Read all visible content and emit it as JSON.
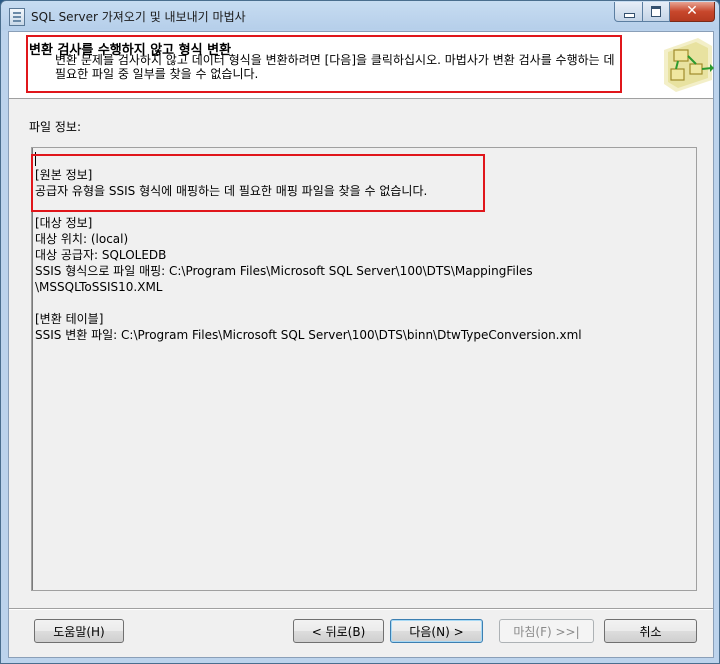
{
  "window": {
    "title": "SQL Server 가져오기 및 내보내기 마법사"
  },
  "header": {
    "title": "변환 검사를 수행하지 않고 형식 변환",
    "description": "변환 문제를 검사하지 않고 데이터 형식을 변환하려면 [다음]을 클릭하십시오. 마법사가 변환 검사를 수행하는 데 필요한 파일 중 일부를 찾을 수 없습니다."
  },
  "file_info_label": "파일 정보:",
  "info": {
    "source_header": "[원본 정보]",
    "source_line": "공급자 유형을 SSIS 형식에 매핑하는 데 필요한 매핑 파일을 찾을 수 없습니다.",
    "dest_header": "[대상 정보]",
    "dest_location": "대상 위치: (local)",
    "dest_provider": "대상 공급자: SQLOLEDB",
    "dest_mapping_1": "SSIS 형식으로 파일 매핑: C:\\Program Files\\Microsoft SQL Server\\100\\DTS\\MappingFiles",
    "dest_mapping_2": "\\MSSQLToSSIS10.XML",
    "conv_header": "[변환 테이블]",
    "conv_file": "SSIS 변환 파일: C:\\Program Files\\Microsoft SQL Server\\100\\DTS\\binn\\DtwTypeConversion.xml"
  },
  "buttons": {
    "help": "도움말(H)",
    "back": "< 뒤로(B)",
    "next": "다음(N) >",
    "finish": "마침(F) >>|",
    "cancel": "취소"
  },
  "colors": {
    "highlight": "#e0161b",
    "title_bar": "#b9d1ea",
    "close_button": "#c7462b"
  }
}
